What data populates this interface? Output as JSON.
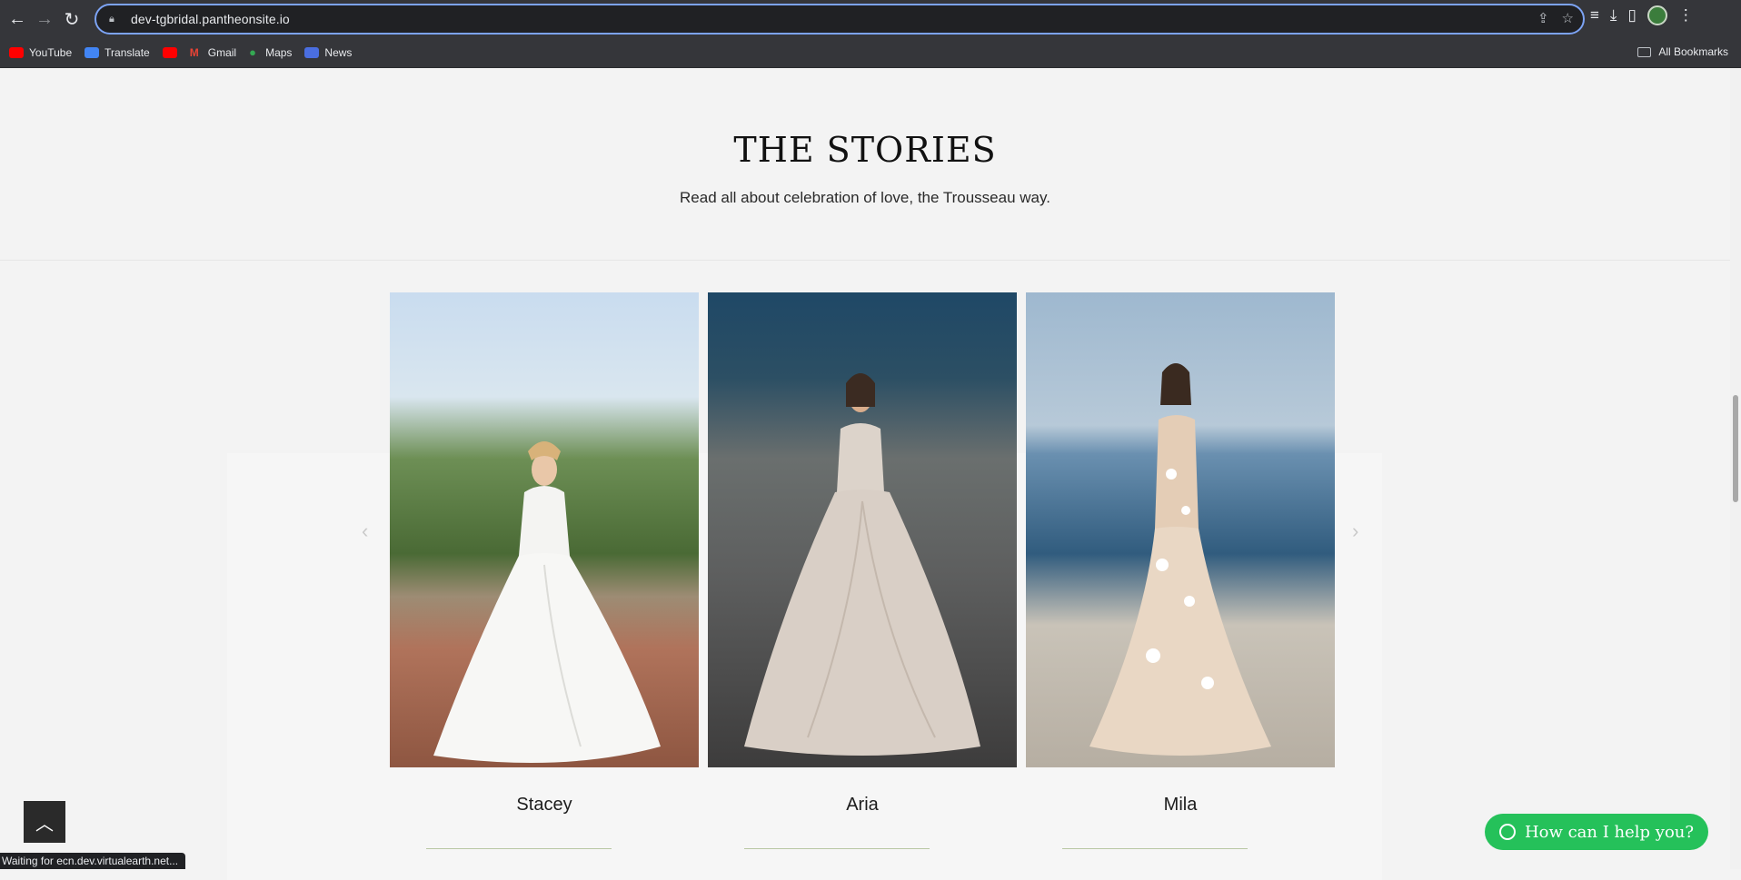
{
  "browser": {
    "url": "dev-tgbridal.pantheonsite.io",
    "bookmarks": [
      {
        "label": "YouTube",
        "icon": "youtube-icon"
      },
      {
        "label": "Translate",
        "icon": "translate-icon"
      },
      {
        "label": "",
        "icon": "youtube-icon"
      },
      {
        "label": "Gmail",
        "icon": "gmail-icon"
      },
      {
        "label": "Maps",
        "icon": "maps-icon"
      },
      {
        "label": "News",
        "icon": "news-icon"
      }
    ],
    "all_bookmarks": "All Bookmarks",
    "status_text": "Waiting for ecn.dev.virtualearth.net..."
  },
  "section": {
    "title": "THE STORIES",
    "subtitle": "Read all about celebration of love, the Trousseau way."
  },
  "stories": [
    {
      "name": "Stacey"
    },
    {
      "name": "Aria"
    },
    {
      "name": "Mila"
    }
  ],
  "chat_button": "How can I help you?",
  "colors": {
    "accent_green": "#25c15a",
    "heading": "#111111",
    "background": "#f3f3f3"
  }
}
